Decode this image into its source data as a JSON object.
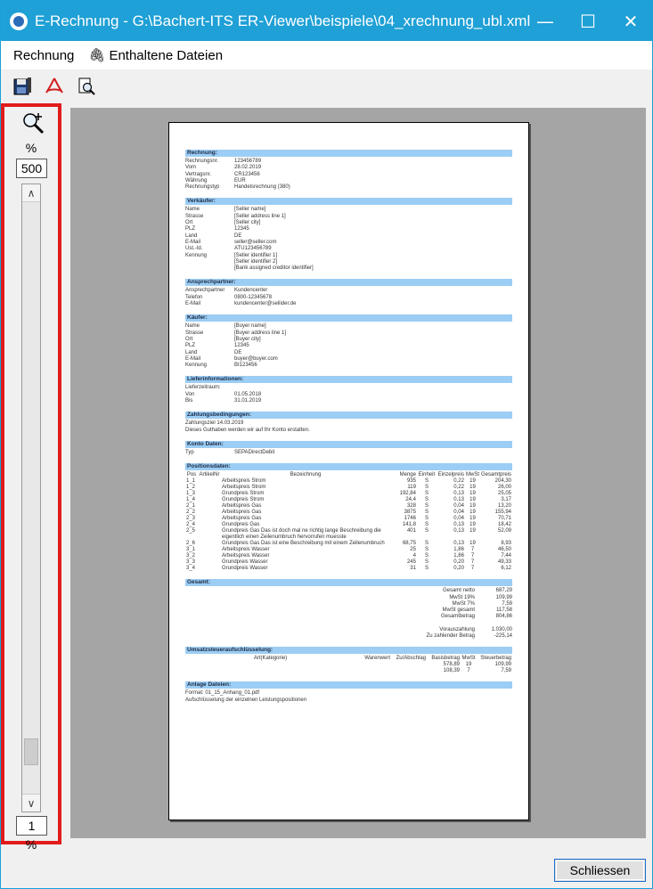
{
  "window": {
    "title": "E-Rechnung - G:\\Bachert-ITS ER-Viewer\\beispiele\\04_xrechnung_ubl.xml",
    "controls": {
      "minimize": "—",
      "maximize": "☐",
      "close": "✕"
    }
  },
  "menu": {
    "rechnung": "Rechnung",
    "enthaltene_dateien": "Enthaltene Dateien"
  },
  "toolbar": {
    "icons": [
      "save-icon",
      "pdf-icon",
      "print-preview-icon"
    ]
  },
  "zoom": {
    "percent_label": "%",
    "value": "500",
    "min_value": "1",
    "min_label": "%"
  },
  "document": {
    "rechnung": {
      "head": "Rechnung:",
      "rows": [
        {
          "k": "Rechnungsnr.",
          "v": "123456789"
        },
        {
          "k": "Vom",
          "v": "28.02.2019"
        },
        {
          "k": "Vertragsnr.",
          "v": "CR123456"
        },
        {
          "k": "Währung",
          "v": "EUR"
        },
        {
          "k": "Rechnungstyp",
          "v": "Handelsrechnung (380)"
        }
      ]
    },
    "verkaeufer": {
      "head": "Verkäufer:",
      "rows": [
        {
          "k": "Name",
          "v": "[Seller name]"
        },
        {
          "k": "Strasse",
          "v": "[Seller address line 1]"
        },
        {
          "k": "Ort",
          "v": "[Seller city]"
        },
        {
          "k": "PLZ",
          "v": "12345"
        },
        {
          "k": "Land",
          "v": "DE"
        },
        {
          "k": "E-Mail",
          "v": "seller@seller.com"
        },
        {
          "k": "Ust.-Id.",
          "v": "ATU123456789"
        },
        {
          "k": "Kennung",
          "v": "[Seller identifier 1]"
        },
        {
          "k": "",
          "v": "[Seller identifier 2]"
        },
        {
          "k": "",
          "v": "[Bank assigned creditor identifier]"
        }
      ]
    },
    "ansprechpartner": {
      "head": "Ansprechpartner:",
      "rows": [
        {
          "k": "Ansprechpartner",
          "v": "Kundencenter"
        },
        {
          "k": "Telefon",
          "v": "0800-12345678"
        },
        {
          "k": "E-Mail",
          "v": "kundencenter@seliider.de"
        }
      ]
    },
    "kaeufer": {
      "head": "Käufer:",
      "rows": [
        {
          "k": "Name",
          "v": "[Buyer name]"
        },
        {
          "k": "Strasse",
          "v": "[Buyer address line 1]"
        },
        {
          "k": "Ort",
          "v": "[Buyer city]"
        },
        {
          "k": "PLZ",
          "v": "12345"
        },
        {
          "k": "Land",
          "v": "DE"
        },
        {
          "k": "E-Mail",
          "v": "buyer@buyer.com"
        },
        {
          "k": "Kennung",
          "v": "BI123456"
        }
      ]
    },
    "liefer": {
      "head": "Lieferinformationen:",
      "label": "Lieferzeitraum:",
      "rows": [
        {
          "k": "Von",
          "v": "01.05.2018"
        },
        {
          "k": "Bis",
          "v": "31.01.2019"
        }
      ]
    },
    "zahlung": {
      "head": "Zahlungsbedingungen:",
      "line1": "Zahlungsziel 14.03.2019",
      "line2": "Dieses Guthaben werden wir auf Ihr Konto erstatten."
    },
    "konto": {
      "head": "Konto Daten:",
      "rows": [
        {
          "k": "Typ",
          "v": "SEPADirectDebit"
        }
      ]
    },
    "positionen": {
      "head": "Positionsdaten:",
      "columns": [
        "Pos",
        "ArtikelNr",
        "Bezeichnung",
        "Menge",
        "Einheit",
        "Einzelpreis",
        "MwSt",
        "Gesamtpreis"
      ],
      "rows": [
        [
          "1_1",
          "",
          "Arbeitspreis Strom",
          "935",
          "S",
          "0,22",
          "19",
          "204,30"
        ],
        [
          "1_2",
          "",
          "Arbeitspreis Strom",
          "119",
          "S",
          "0,22",
          "19",
          "26,00"
        ],
        [
          "1_3",
          "",
          "Grundpreis Strom",
          "192,84",
          "S",
          "0,13",
          "19",
          "25,05"
        ],
        [
          "1_4",
          "",
          "Grundpreis Strom",
          "24,4",
          "S",
          "0,13",
          "19",
          "3,17"
        ],
        [
          "2_1",
          "",
          "Arbeitspreis Gas",
          "328",
          "S",
          "0,04",
          "19",
          "13,20"
        ],
        [
          "2_2",
          "",
          "Arbeitspreis Gas",
          "3875",
          "S",
          "0,04",
          "19",
          "155,94"
        ],
        [
          "2_3",
          "",
          "Arbeitspreis Gas",
          "1746",
          "S",
          "0,04",
          "19",
          "70,71"
        ],
        [
          "2_4",
          "",
          "Grundpreis Gas",
          "141,8",
          "S",
          "0,13",
          "19",
          "18,42"
        ],
        [
          "2_5",
          "",
          "Grundpreis Gas Das ist doch mal ne richtig lange Beschreibung die eigentlich einen Zeilenumbruch hervorrufen muesste",
          "401",
          "S",
          "0,13",
          "19",
          "52,09"
        ],
        [
          "2_6",
          "",
          "Grundpreis Gas Das ist eine Beschreibung mit einem Zeilenumbruch",
          "68,75",
          "S",
          "0,13",
          "19",
          "8,93"
        ],
        [
          "3_1",
          "",
          "Arbeitspreis Wasser",
          "25",
          "S",
          "1,86",
          "7",
          "46,50"
        ],
        [
          "3_2",
          "",
          "Arbeitspreis Wasser",
          "4",
          "S",
          "1,86",
          "7",
          "7,44"
        ],
        [
          "3_3",
          "",
          "Grundpreis Wasser",
          "245",
          "S",
          "0,20",
          "7",
          "49,33"
        ],
        [
          "3_4",
          "",
          "Grundpreis Wasser",
          "31",
          "S",
          "0,20",
          "7",
          "6,12"
        ]
      ]
    },
    "gesamt": {
      "head": "Gesamt:",
      "rows": [
        {
          "k": "Gesamt netto",
          "v": "687,29"
        },
        {
          "k": "MwSt 19%",
          "v": "109,99"
        },
        {
          "k": "MwSt 7%",
          "v": "7,59"
        },
        {
          "k": "MwSt gesamt",
          "v": "117,58"
        },
        {
          "k": "Gesamtbetrag",
          "v": "804,86"
        }
      ],
      "rows2": [
        {
          "k": "Vorauszahlung",
          "v": "1.030,00"
        },
        {
          "k": "Zu zahlender Betrag",
          "v": "-225,14"
        }
      ]
    },
    "ust": {
      "head": "Umsatzsteueraufschlüsselung:",
      "columns": [
        "Art(Kategorie)",
        "Warenwert",
        "Zu/Abschlag",
        "Basisbetrag",
        "MwSt",
        "Steuerbetrag"
      ],
      "rows": [
        [
          "",
          "",
          "",
          "578,89",
          "19",
          "109,99"
        ],
        [
          "",
          "",
          "",
          "108,39",
          "7",
          "7,59"
        ]
      ]
    },
    "anlage": {
      "head": "Anlage Dateien:",
      "line1": "Format: 01_15_Anhang_01.pdf",
      "line2": "Aufschlüsselung der einzelnen Leistungspositionen"
    }
  },
  "footer": {
    "close_label": "Schliessen"
  }
}
